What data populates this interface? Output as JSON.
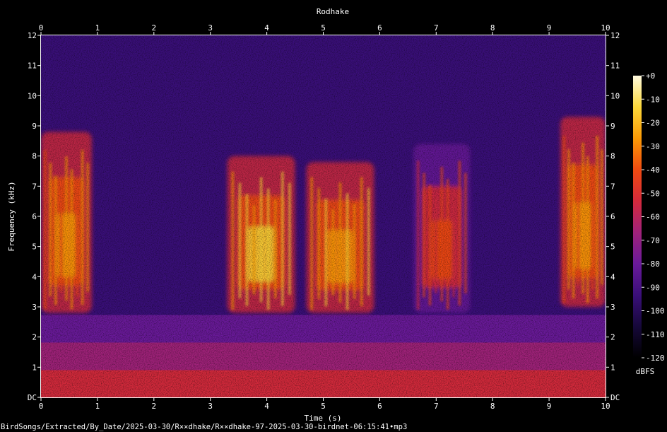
{
  "chart_data": {
    "type": "heatmap",
    "title": "Rodhake",
    "xlabel": "Time (s)",
    "ylabel": "Frequency (kHz)",
    "xlim": [
      0,
      10
    ],
    "ylim": [
      0,
      12
    ],
    "x_ticks": [
      "0",
      "1",
      "2",
      "3",
      "4",
      "5",
      "6",
      "7",
      "8",
      "9",
      "10"
    ],
    "y_ticks": [
      "DC",
      "1",
      "2",
      "3",
      "4",
      "5",
      "6",
      "7",
      "8",
      "9",
      "10",
      "11",
      "12"
    ],
    "colorbar": {
      "unit": "dBFS",
      "range": [
        -120,
        0
      ],
      "ticks": [
        "+0",
        "-10",
        "-20",
        "-30",
        "-40",
        "-50",
        "-60",
        "-70",
        "-80",
        "-90",
        "-100",
        "-110",
        "-120"
      ],
      "colormap": [
        "#000000",
        "#16083a",
        "#3a0f7a",
        "#6a1a9a",
        "#a0227a",
        "#d42a3c",
        "#f04a10",
        "#fb9a06",
        "#fcd83a",
        "#fffbe0"
      ]
    },
    "grid": false,
    "energy_regions": [
      {
        "t": [
          0.0,
          0.9
        ],
        "f": [
          2.8,
          8.8
        ],
        "peak_db": -30
      },
      {
        "t": [
          3.3,
          4.5
        ],
        "f": [
          2.8,
          8.0
        ],
        "peak_db": -20
      },
      {
        "t": [
          4.7,
          5.9
        ],
        "f": [
          2.8,
          7.8
        ],
        "peak_db": -25
      },
      {
        "t": [
          6.6,
          7.6
        ],
        "f": [
          2.8,
          8.4
        ],
        "peak_db": -45
      },
      {
        "t": [
          9.2,
          10.0
        ],
        "f": [
          3.0,
          9.3
        ],
        "peak_db": -30
      }
    ],
    "low_frequency_band": {
      "f": [
        0,
        2.0
      ],
      "peak_db": -50
    }
  },
  "footer": {
    "filepath": "BirdSongs/Extracted/By_Date/2025-03-30/R××dhake/R××dhake-97-2025-03-30-birdnet-06:15:41•mp3"
  }
}
